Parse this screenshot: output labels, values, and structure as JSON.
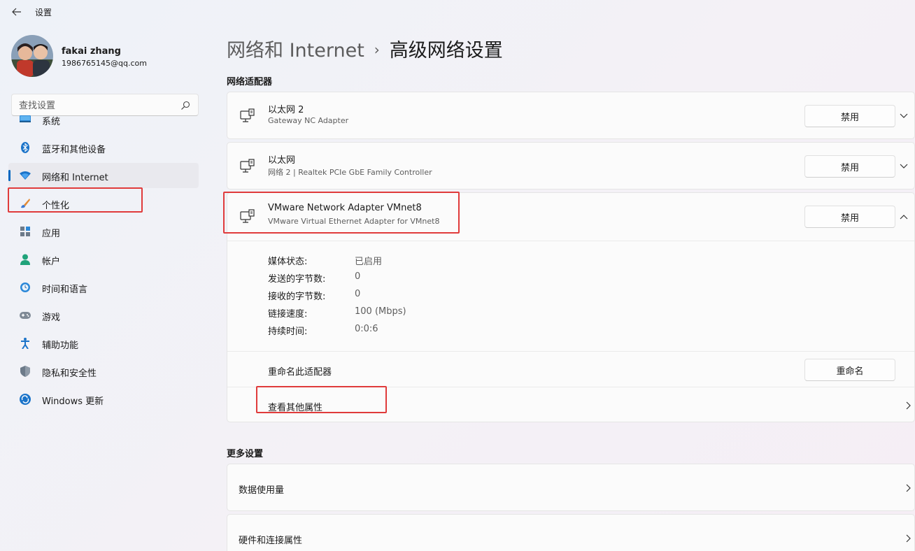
{
  "app": {
    "title": "设置"
  },
  "user": {
    "name": "fakai zhang",
    "email": "1986765145@qq.com"
  },
  "search": {
    "placeholder": "查找设置"
  },
  "sidebar": {
    "items": [
      {
        "label": "系统",
        "icon": "system-icon"
      },
      {
        "label": "蓝牙和其他设备",
        "icon": "bluetooth-icon"
      },
      {
        "label": "网络和 Internet",
        "icon": "wifi-icon",
        "selected": true
      },
      {
        "label": "个性化",
        "icon": "brush-icon"
      },
      {
        "label": "应用",
        "icon": "apps-icon"
      },
      {
        "label": "帐户",
        "icon": "account-icon"
      },
      {
        "label": "时间和语言",
        "icon": "globe-clock-icon"
      },
      {
        "label": "游戏",
        "icon": "gamepad-icon"
      },
      {
        "label": "辅助功能",
        "icon": "accessibility-icon"
      },
      {
        "label": "隐私和安全性",
        "icon": "shield-icon"
      },
      {
        "label": "Windows 更新",
        "icon": "update-icon"
      }
    ]
  },
  "breadcrumb": {
    "parent": "网络和 Internet",
    "separator": "›",
    "current": "高级网络设置"
  },
  "adapters_section": {
    "title": "网络适配器"
  },
  "adapters": [
    {
      "name": "以太网 2",
      "description": "Gateway NC Adapter",
      "button": "禁用",
      "expanded": false
    },
    {
      "name": "以太网",
      "description": "网络 2 | Realtek PCIe GbE Family Controller",
      "button": "禁用",
      "expanded": false
    },
    {
      "name": "VMware Network Adapter VMnet8",
      "description": "VMware Virtual Ethernet Adapter for VMnet8",
      "button": "禁用",
      "expanded": true
    }
  ],
  "details": [
    {
      "label": "媒体状态:",
      "value": "已启用"
    },
    {
      "label": "发送的字节数:",
      "value": "0"
    },
    {
      "label": "接收的字节数:",
      "value": "0"
    },
    {
      "label": "链接速度:",
      "value": "100 (Mbps)"
    },
    {
      "label": "持续时间:",
      "value": "0:0:6"
    }
  ],
  "rename": {
    "label": "重命名此适配器",
    "button": "重命名"
  },
  "more_props": {
    "label": "查看其他属性"
  },
  "more_section": {
    "title": "更多设置"
  },
  "more_items": [
    {
      "label": "数据使用量"
    },
    {
      "label": "硬件和连接属性"
    }
  ],
  "colors": {
    "accent": "#0067c0",
    "highlight": "#e03b3b"
  }
}
